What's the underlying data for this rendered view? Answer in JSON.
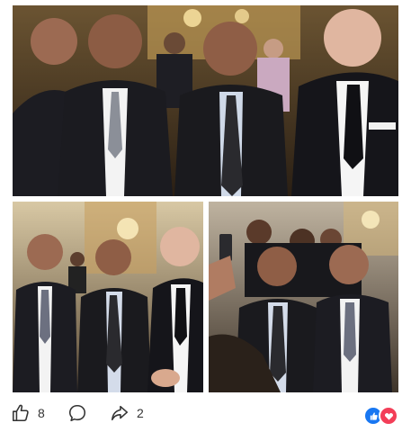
{
  "post": {
    "photos": [
      {
        "id": "photo-top",
        "icon": "group-photo"
      },
      {
        "id": "photo-bottom-left",
        "icon": "group-photo"
      },
      {
        "id": "photo-bottom-right",
        "icon": "group-photo"
      }
    ],
    "actions": {
      "like": {
        "icon": "thumbs-up-icon",
        "count": "8"
      },
      "comment": {
        "icon": "comment-bubble-icon"
      },
      "share": {
        "icon": "share-arrow-icon",
        "count": "2"
      }
    },
    "reactions": [
      {
        "icon": "like-reaction-icon",
        "color": "#1877f2"
      },
      {
        "icon": "love-reaction-icon",
        "color": "#f33e58"
      }
    ]
  }
}
